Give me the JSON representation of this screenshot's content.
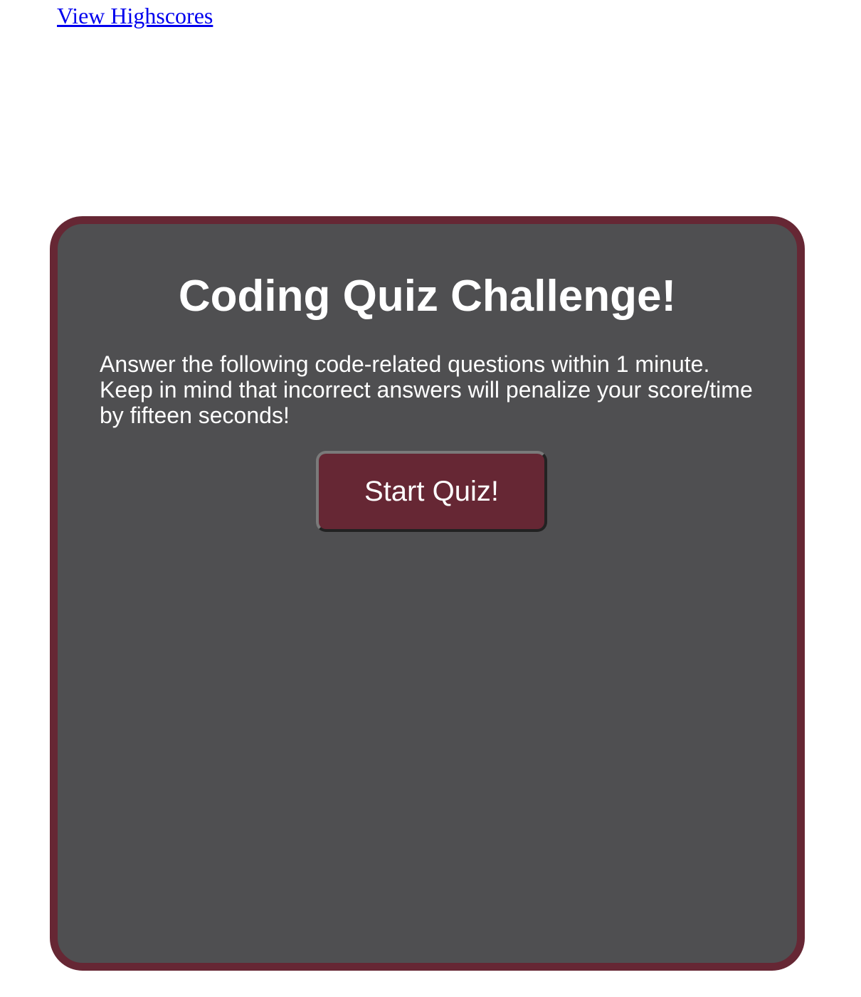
{
  "nav": {
    "highscores_link": "View Highscores"
  },
  "quiz": {
    "title": "Coding Quiz Challenge!",
    "instructions": "Answer the following code-related questions within 1 minute. Keep in mind that incorrect answers will penalize your score/time by fifteen seconds!",
    "start_button": "Start Quiz!"
  },
  "colors": {
    "card_background": "#4f4f51",
    "card_border": "#662734",
    "button_background": "#662734",
    "link": "#0000ee",
    "text": "#ffffff"
  }
}
